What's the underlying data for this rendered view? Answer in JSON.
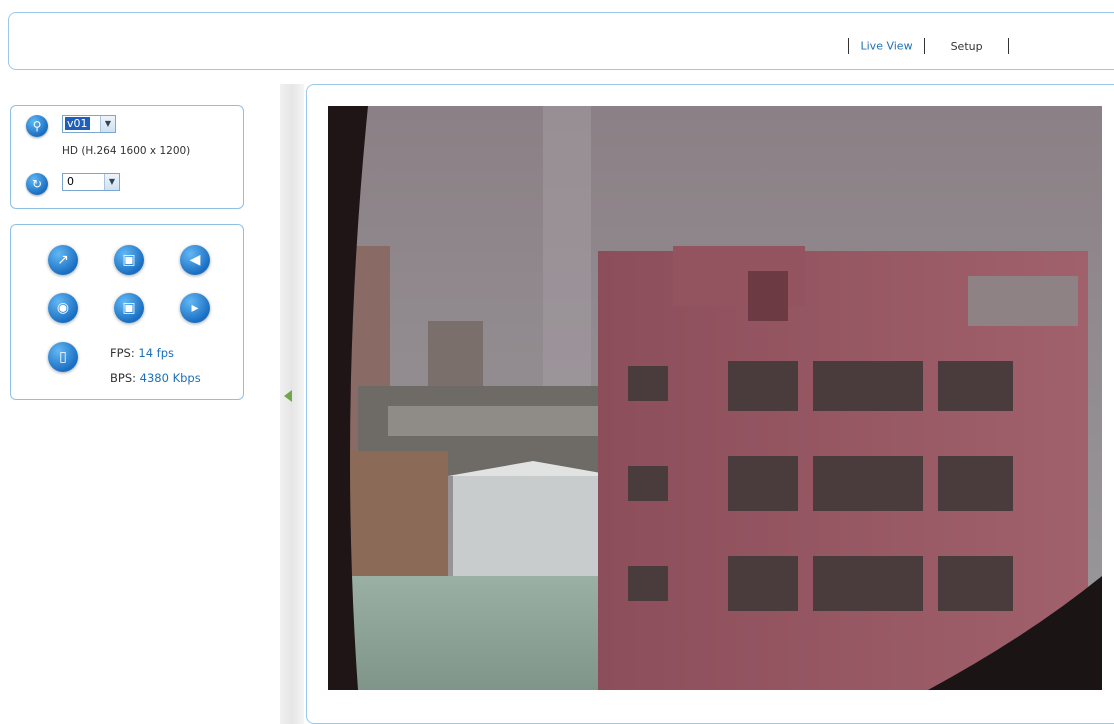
{
  "nav": {
    "live_view": "Live View",
    "setup": "Setup"
  },
  "stream": {
    "selected": "v01",
    "info": "HD (H.264 1600 x 1200)"
  },
  "rotate": {
    "selected": "0"
  },
  "controls": {
    "icons": [
      "fullscreen-icon",
      "view-window-icon",
      "audio-speaker-icon",
      "ptz-control-icon",
      "snapshot-icon",
      "video-record-icon",
      "folder-icon"
    ]
  },
  "stats": {
    "fps_label": "FPS:",
    "fps_value": "14 fps",
    "bps_label": "BPS:",
    "bps_value": "4380 Kbps"
  }
}
